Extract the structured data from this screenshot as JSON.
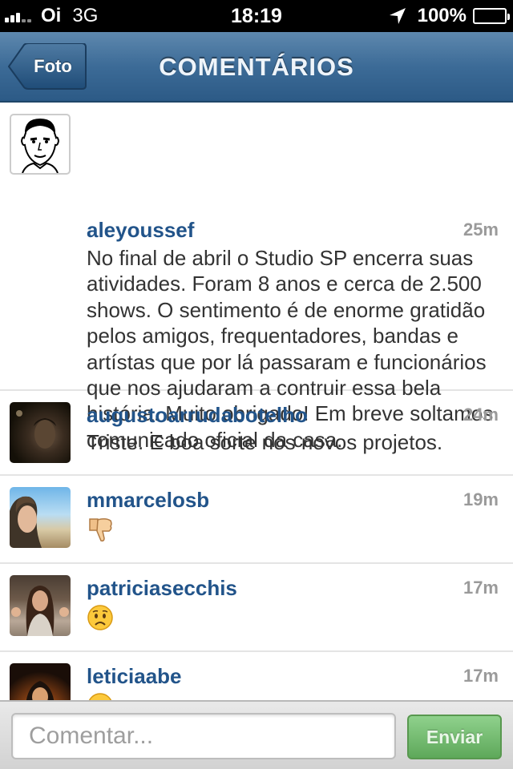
{
  "status_bar": {
    "carrier": "Oi",
    "network": "3G",
    "time": "18:19",
    "battery": "100%",
    "icons": [
      "signal-icon",
      "location-arrow-icon",
      "battery-icon"
    ]
  },
  "nav": {
    "back_label": "Foto",
    "title": "COMENTÁRIOS"
  },
  "comments": [
    {
      "user": "aleyoussef",
      "time": "25m",
      "text": "No final de abril o Studio SP encerra suas atividades. Foram 8 anos e cerca de 2.500 shows. O sentimento é de enorme gratidão pelos amigos, frequentadores, bandas e artístas que por lá passaram e funcionários que nos ajudaram a contruir essa bela história. Muito obrigado! Em breve soltamos comunicado oficial da casa."
    },
    {
      "user": "augustoarrudabotelho",
      "time": "24m",
      "text": "Triste. E boa sorte nos novos projetos."
    },
    {
      "user": "mmarcelosb",
      "time": "19m",
      "emoji": "thumbs-down-icon"
    },
    {
      "user": "patriciasecchis",
      "time": "17m",
      "emoji": "worried-face-icon"
    },
    {
      "user": "leticiaabe",
      "time": "17m",
      "emoji": "face-icon"
    }
  ],
  "compose": {
    "placeholder": "Comentar...",
    "send_label": "Enviar"
  },
  "colors": {
    "nav_bar": "#3c6b97",
    "username": "#22548a",
    "send_button": "#6cb869"
  }
}
